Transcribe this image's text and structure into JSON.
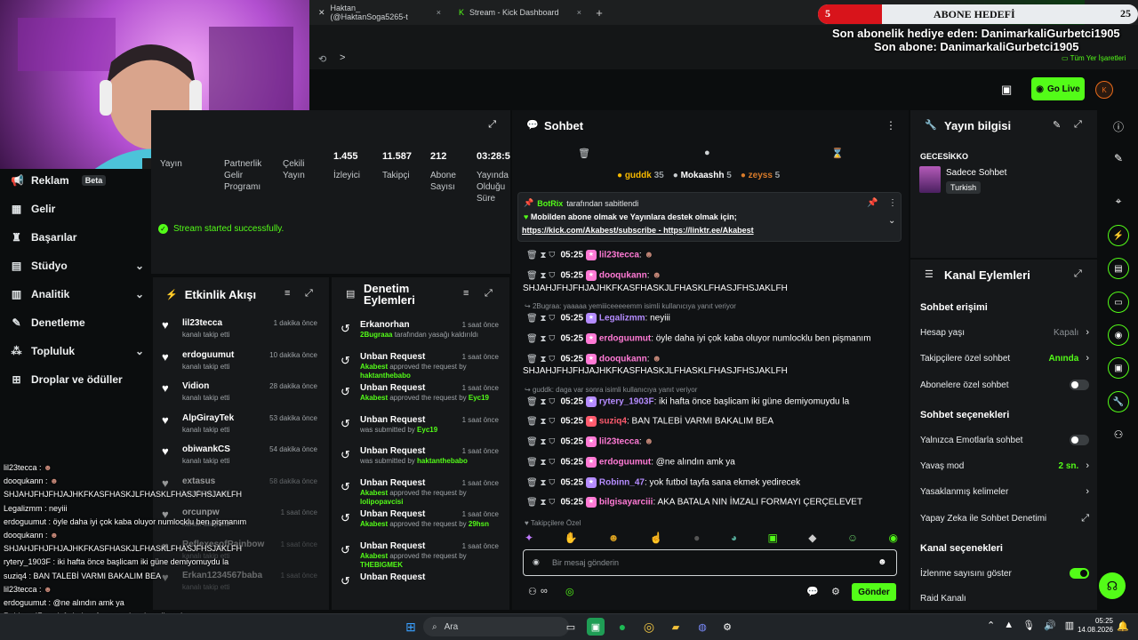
{
  "browser": {
    "tabs": [
      {
        "label": "Haktan_ (@HaktanSoga5265-t"
      },
      {
        "label": "Stream - Kick Dashboard"
      }
    ],
    "bookmarks_label": "Tüm Yer İşaretleri"
  },
  "overlay": {
    "goal_current": "5",
    "goal_title": "ABONE HEDEFİ",
    "goal_target": "25",
    "goal_progress": 0.2,
    "gift_line": "Son abonelik hediye eden: DanimarkaliGurbetci1905",
    "sub_line": "Son abone: DanimarkaliGurbetci1905"
  },
  "header": {
    "go_live_label": "Go Live"
  },
  "sidebar": {
    "items": [
      {
        "label": "Reklam",
        "badge": "Beta"
      },
      {
        "label": "Gelir"
      },
      {
        "label": "Başarılar"
      },
      {
        "label": "Stüdyo"
      },
      {
        "label": "Analitik"
      },
      {
        "label": "Denetleme"
      },
      {
        "label": "Topluluk"
      },
      {
        "label": "Droplar ve ödüller"
      }
    ]
  },
  "stats": {
    "items": [
      {
        "value": "",
        "label": "Yayın"
      },
      {
        "value": "",
        "label": "Partnerlik Gelir Programı"
      },
      {
        "value": "",
        "label": "Çekili Yayın"
      },
      {
        "value": "1.455",
        "label": "İzleyici"
      },
      {
        "value": "11.587",
        "label": "Takipçi"
      },
      {
        "value": "212",
        "label": "Abone Sayısı"
      },
      {
        "value": "03:28:5",
        "label": "Yayında Olduğu Süre"
      }
    ],
    "success_message": "Stream started successfully."
  },
  "activity": {
    "title": "Etkinlik Akışı",
    "items": [
      {
        "name": "lil23tecca",
        "sub": "kanalı takip etti",
        "time": "1 dakika önce"
      },
      {
        "name": "erdoguumut",
        "sub": "kanalı takip etti",
        "time": "10 dakika önce"
      },
      {
        "name": "Vidion",
        "sub": "kanalı takip etti",
        "time": "28 dakika önce"
      },
      {
        "name": "AlpGirayTek",
        "sub": "kanalı takip etti",
        "time": "53 dakika önce"
      },
      {
        "name": "obiwankCS",
        "sub": "kanalı takip etti",
        "time": "54 dakika önce"
      },
      {
        "name": "extasus",
        "sub": "kanalı takip etti",
        "time": "58 dakika önce"
      },
      {
        "name": "orcunpw",
        "sub": "kanalı takip etti",
        "time": "1 saat önce"
      },
      {
        "name": "ReflexesofRainbow",
        "sub": "kanalı takip etti",
        "time": "1 saat önce"
      },
      {
        "name": "Erkan1234567baba",
        "sub": "kanalı takip etti",
        "time": "1 saat önce"
      }
    ]
  },
  "moderation": {
    "title": "Denetim Eylemleri",
    "items": [
      {
        "name": "Erkanorhan",
        "actor": "2Bugraaa",
        "rest": "tarafından yasağı kaldırıldı",
        "time": "1 saat önce"
      },
      {
        "name": "Unban Request",
        "actor": "Akabest",
        "rest": "approved the request by",
        "target": "haktanthebabo",
        "time": "1 saat önce"
      },
      {
        "name": "Unban Request",
        "actor": "Akabest",
        "rest": "approved the request by",
        "target": "Eyc19",
        "time": "1 saat önce"
      },
      {
        "name": "Unban Request",
        "actor": "",
        "rest": "was submitted by",
        "target": "Eyc19",
        "time": "1 saat önce"
      },
      {
        "name": "Unban Request",
        "actor": "",
        "rest": "was submitted by",
        "target": "haktanthebabo",
        "time": "1 saat önce"
      },
      {
        "name": "Unban Request",
        "actor": "Akabest",
        "rest": "approved the request by",
        "target": "lolipopavcisi",
        "time": "1 saat önce"
      },
      {
        "name": "Unban Request",
        "actor": "Akabest",
        "rest": "approved the request by",
        "target": "29hsn",
        "time": "1 saat önce"
      },
      {
        "name": "Unban Request",
        "actor": "Akabest",
        "rest": "approved the request by",
        "target": "THEBIGMEK",
        "time": "1 saat önce"
      },
      {
        "name": "Unban Request",
        "actor": "",
        "rest": "",
        "target": "",
        "time": ""
      }
    ]
  },
  "chat": {
    "title": "Sohbet",
    "leaders": [
      {
        "name": "guddk",
        "count": "35"
      },
      {
        "name": "Mokaashh",
        "count": "5"
      },
      {
        "name": "zeyss",
        "count": "5"
      }
    ],
    "pinned_by": "BotRix",
    "pinned_suffix": "tarafından sabitlendi",
    "pinned_text": "Mobilden abone olmak ve Yayınlara destek olmak için;",
    "pinned_link1": "https://kick.com/Akabest/subscribe",
    "pinned_sep": " - ",
    "pinned_link2": "https://linktr.ee/Akabest",
    "messages": [
      {
        "time": "05:25",
        "user": "lil23tecca",
        "text": "",
        "color": "#ff7ad5"
      },
      {
        "time": "05:25",
        "user": "dooqukann",
        "text": "",
        "color": "#ff7ad5"
      },
      {
        "time": "",
        "user": "",
        "text": "SHJAHJFHJFHJAJHKFKASFHASKJLFHASKLFHASJFHSJAKLFH",
        "color": "#ffffff"
      },
      {
        "reply": "2Bugraa: yaaaaa yemiiiceeeeemm isimli kullanıcıya yanıt veriyor"
      },
      {
        "time": "05:25",
        "user": "Legalizmm",
        "text": "neyiii",
        "color": "#b58cff"
      },
      {
        "time": "05:25",
        "user": "erdoguumut",
        "text": "öyle daha iyi çok kaba oluyor numlocklu ben pişmanım",
        "color": "#ff7ad5"
      },
      {
        "time": "05:25",
        "user": "dooqukann",
        "text": "",
        "color": "#ff7ad5"
      },
      {
        "time": "",
        "user": "",
        "text": "SHJAHJFHJFHJAJHKFKASFHASKJLFHASKLFHASJFHSJAKLFH",
        "color": "#ffffff"
      },
      {
        "reply": "guddk: daga var sonra isimli kullanıcıya yanıt veriyor"
      },
      {
        "time": "05:25",
        "user": "rytery_1903F",
        "text": "iki hafta önce başlicam iki güne demiyomuydu la",
        "color": "#b58cff"
      },
      {
        "time": "05:25",
        "user": "suziq4",
        "text": "BAN TALEBİ VARMI BAKALIM BEA",
        "color": "#ff5b6e"
      },
      {
        "time": "05:25",
        "user": "lil23tecca",
        "text": "",
        "color": "#ff7ad5"
      },
      {
        "time": "05:25",
        "user": "erdoguumut",
        "text": "@ne alındın amk ya",
        "color": "#ff7ad5"
      },
      {
        "time": "05:25",
        "user": "Robinn_47",
        "text": "yok futbol tayfa sana ekmek yedirecek",
        "color": "#b58cff"
      },
      {
        "time": "05:25",
        "user": "bilgisayarciii",
        "text": "AKA BATALA NIN İMZALI FORMAYI ÇERÇELEVET",
        "color": "#ff7ad5"
      }
    ],
    "followers_only_label": "Takipçilere Özel",
    "input_placeholder": "Bir mesaj gönderin",
    "send_label": "Gönder"
  },
  "stream_info": {
    "title": "Yayın bilgisi",
    "stream_title": "GECESİKKO",
    "category": "Sadece Sohbet",
    "tag": "Turkish"
  },
  "channel_actions": {
    "title": "Kanal Eylemleri",
    "chat_access_heading": "Sohbet erişimi",
    "rows_access": [
      {
        "label": "Hesap yaşı",
        "value": "Kapalı"
      },
      {
        "label": "Takipçilere özel sohbet",
        "value": "Anında"
      },
      {
        "label": "Abonelere özel sohbet",
        "value": ""
      }
    ],
    "chat_options_heading": "Sohbet seçenekleri",
    "rows_options": [
      {
        "label": "Yalnızca Emotlarla sohbet",
        "value": ""
      },
      {
        "label": "Yavaş mod",
        "value": "2 sn."
      },
      {
        "label": "Yasaklanmış kelimeler",
        "value": ""
      },
      {
        "label": "Yapay Zeka ile Sohbet Denetimi",
        "value": ""
      }
    ],
    "channel_options_heading": "Kanal seçenekleri",
    "rows_channel": [
      {
        "label": "İzlenme sayısını göster",
        "value": ""
      },
      {
        "label": "Raid Kanalı",
        "value": ""
      }
    ]
  },
  "overlay_chat": [
    {
      "user": "lil23tecca",
      "text": ""
    },
    {
      "user": "dooqukann",
      "text": ""
    },
    {
      "user": "",
      "text": "SHJAHJFHJFHJAJHKFKASFHASKJLFHASKLFHASJFHSJAKLFH"
    },
    {
      "user": "Legalizmm",
      "text": "neyiii"
    },
    {
      "user": "erdoguumut",
      "text": "öyle daha iyi çok kaba oluyor numlocklu ben pişmanım"
    },
    {
      "user": "dooqukann",
      "text": ""
    },
    {
      "user": "",
      "text": "SHJAHJFHJFHJAJHKFKASFHASKJLFHASKLFHASJFHSJAKLFH"
    },
    {
      "user": "rytery_1903F",
      "text": "iki hafta önce başlicam iki güne demiyomuydu la"
    },
    {
      "user": "suziq4",
      "text": "BAN TALEBİ VARMI BAKALIM BEA"
    },
    {
      "user": "lil23tecca",
      "text": ""
    },
    {
      "user": "erdoguumut",
      "text": "@ne alındın amk ya"
    },
    {
      "user": "Robinn_47",
      "text": "yok futbol tayfa sana ekmek yedirecek"
    },
    {
      "user": "bilgisayarciii",
      "text": "AKA BATALA NIN İMZALI FORMAYI ÇERÇELEVET"
    }
  ],
  "taskbar": {
    "search_label": "Ara",
    "time": "05:25",
    "date": "14.08.2026"
  },
  "colors": {
    "accent": "#53fc18",
    "panel": "#16181a",
    "goal_red": "#d8141b"
  }
}
